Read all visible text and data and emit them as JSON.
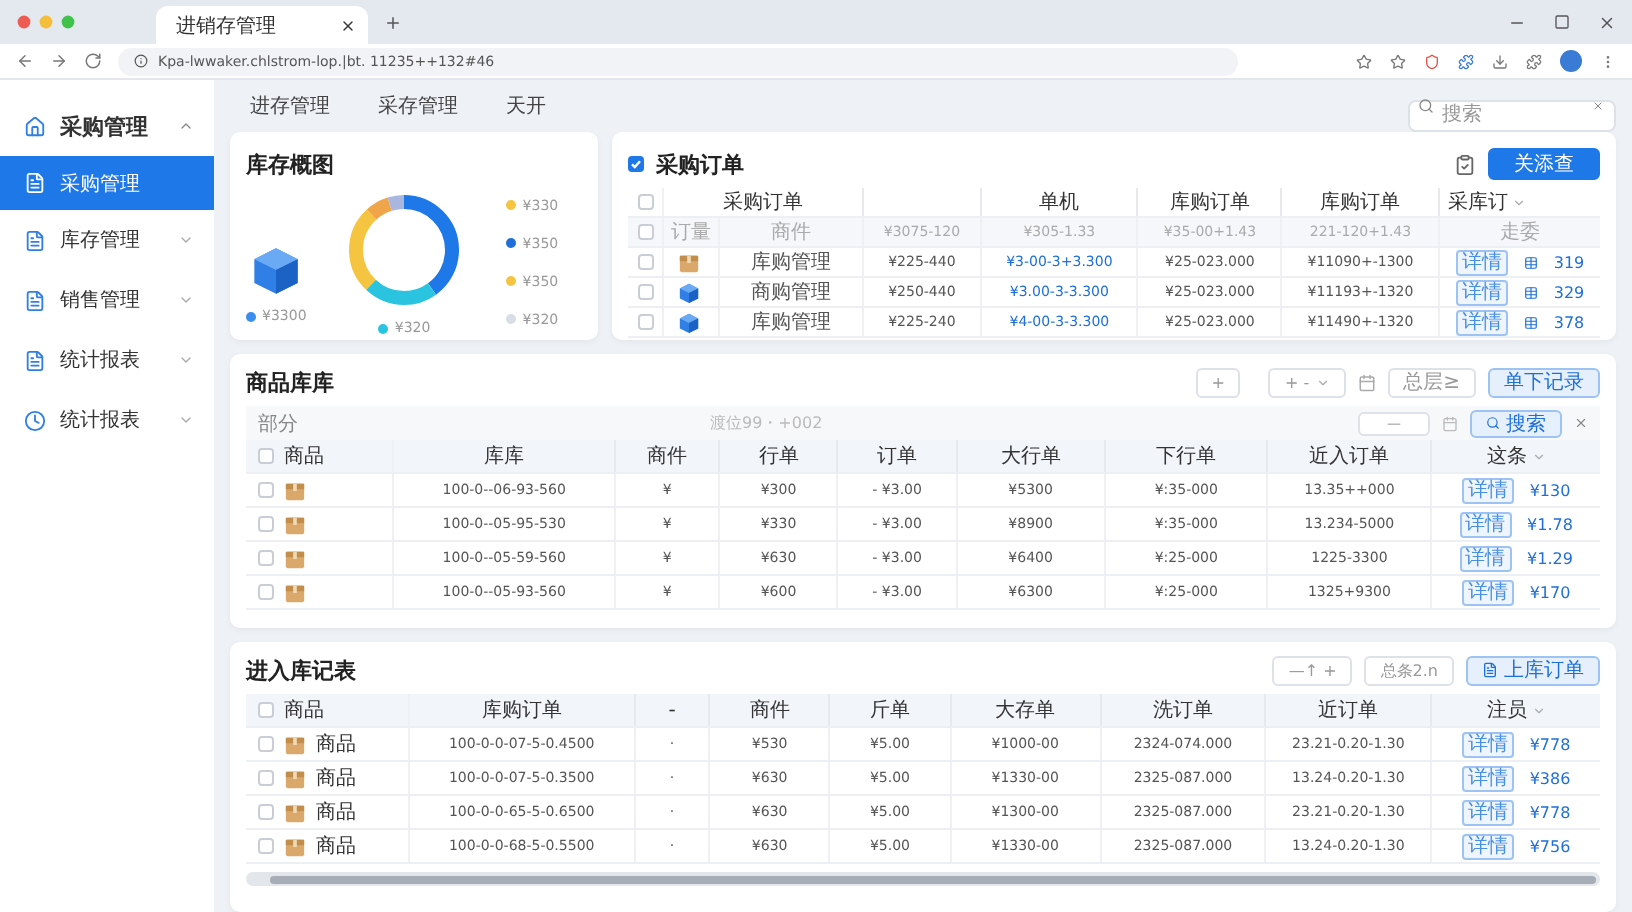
{
  "browser": {
    "tab_title": "进销存管理",
    "url": "Kpa-lwwaker.chlstrom-lop.|bt. 11235++132#46"
  },
  "sidebar": {
    "items": [
      {
        "label": "采购管理",
        "kind": "group",
        "selected": false,
        "expanded": true
      },
      {
        "label": "采购管理",
        "kind": "sub",
        "selected": true
      },
      {
        "label": "库存管理",
        "kind": "group",
        "selected": false,
        "expanded": false
      },
      {
        "label": "销售管理",
        "kind": "group",
        "selected": false,
        "expanded": false
      },
      {
        "label": "统计报表",
        "kind": "group",
        "selected": false,
        "expanded": false
      },
      {
        "label": "统计报表",
        "kind": "group",
        "selected": false,
        "expanded": false
      }
    ]
  },
  "subnav": {
    "tabs": [
      "进存管理",
      "采存管理",
      "天开"
    ],
    "search": {
      "placeholder": "搜索"
    }
  },
  "overview": {
    "title": "库存概图",
    "stock": {
      "label": "¥3300",
      "color": "#3a8ef0"
    },
    "center": {
      "label": "¥320",
      "color": "#2bc4e0"
    },
    "legend": [
      {
        "label": "¥330",
        "color": "#f5c542"
      },
      {
        "label": "¥350",
        "color": "#1e6fd9"
      },
      {
        "label": "¥350",
        "color": "#f5c542"
      },
      {
        "label": "¥320",
        "color": "#d9dde6"
      }
    ]
  },
  "orders": {
    "title": "采购订单",
    "checked": true,
    "button": "关添查",
    "all_checked": false,
    "sub_checked": false,
    "columns": [
      "采购订单",
      "单机",
      "库购订单",
      "库购订单",
      "采库订"
    ],
    "sub_header": [
      "订量",
      "商件",
      "¥3075-120",
      "¥305-1.33",
      "¥35-00+1.43",
      "221-120+1.43",
      "走委"
    ],
    "rows": [
      {
        "checked": false,
        "kind": "parcel",
        "name": "库购管理",
        "price": "¥225-440",
        "total": "¥3-00-3+3.300",
        "order": "¥25-023.000",
        "stock": "¥11090+-1300",
        "tag": "详情",
        "amount": "319"
      },
      {
        "checked": false,
        "kind": "cube",
        "name": "商购管理",
        "price": "¥250-440",
        "total": "¥3.00-3-3.300",
        "order": "¥25-023.000",
        "stock": "¥11193+-1320",
        "tag": "详情",
        "amount": "329"
      },
      {
        "checked": false,
        "kind": "cube",
        "name": "库购管理",
        "price": "¥225-240",
        "total": "¥4-00-3-3.300",
        "order": "¥25-023.000",
        "stock": "¥11490+-1320",
        "tag": "详情",
        "amount": "378"
      }
    ]
  },
  "goods": {
    "title": "商品库库",
    "toolbar": {
      "add": "+",
      "range": "+ -",
      "summary": "总层≥",
      "primary": "单下记录"
    },
    "filter": {
      "label": "部分",
      "placeholder": "渡位99・+002",
      "range_value": "—",
      "search": "搜索"
    },
    "all_checked": false,
    "product_header": "商品",
    "columns": [
      "库库",
      "商件",
      "行单",
      "订单",
      "大行单",
      "下行单",
      "近入订单",
      "这条"
    ],
    "rows": [
      {
        "checked": false,
        "cells": [
          "100-0--06-93-560",
          "¥",
          "¥300",
          "- ¥3.00",
          "¥5300",
          "¥:35-000",
          "13.35++000"
        ],
        "tag": "详情",
        "amount": "¥130"
      },
      {
        "checked": false,
        "cells": [
          "100-0--05-95-530",
          "¥",
          "¥330",
          "- ¥3.00",
          "¥8900",
          "¥:35-000",
          "13.234-5000"
        ],
        "tag": "详情",
        "amount": "¥1.78"
      },
      {
        "checked": false,
        "cells": [
          "100-0--05-59-560",
          "¥",
          "¥630",
          "- ¥3.00",
          "¥6400",
          "¥:25-000",
          "1225-3300"
        ],
        "tag": "详情",
        "amount": "¥1.29"
      },
      {
        "checked": false,
        "cells": [
          "100-0--05-93-560",
          "¥",
          "¥600",
          "- ¥3.00",
          "¥6300",
          "¥:25-000",
          "1325+9300"
        ],
        "tag": "详情",
        "amount": "¥170"
      }
    ]
  },
  "records": {
    "title": "进入库记表",
    "toolbar": {
      "range": "—↑ +",
      "summary": "总条2.n",
      "primary": "上库订单"
    },
    "all_checked": false,
    "product_header": "商品",
    "columns": [
      "库购订单",
      "-",
      "商件",
      "斤单",
      "大存单",
      "洗订单",
      "近订单",
      "注员"
    ],
    "rows": [
      {
        "checked": false,
        "name": "商品",
        "cells": [
          "100-0-0-07-5-0.4500",
          "·",
          "¥530",
          "¥5.00",
          "¥1000-00",
          "2324-074.000",
          "23.21-0.20-1.30"
        ],
        "tag": "详情",
        "amount": "¥778"
      },
      {
        "checked": false,
        "name": "商品",
        "cells": [
          "100-0-0-07-5-0.3500",
          "·",
          "¥630",
          "¥5.00",
          "¥1330-00",
          "2325-087.000",
          "13.24-0.20-1.30"
        ],
        "tag": "详情",
        "amount": "¥386"
      },
      {
        "checked": false,
        "name": "商品",
        "cells": [
          "100-0-0-65-5-0.6500",
          "·",
          "¥630",
          "¥5.00",
          "¥1300-00",
          "2325-087.000",
          "23.21-0.20-1.30"
        ],
        "tag": "详情",
        "amount": "¥778"
      },
      {
        "checked": false,
        "name": "商品",
        "cells": [
          "100-0-0-68-5-0.5500",
          "·",
          "¥630",
          "¥5.00",
          "¥1330-00",
          "2325-087.000",
          "13.24-0.20-1.30"
        ],
        "tag": "详情",
        "amount": "¥756"
      }
    ]
  }
}
